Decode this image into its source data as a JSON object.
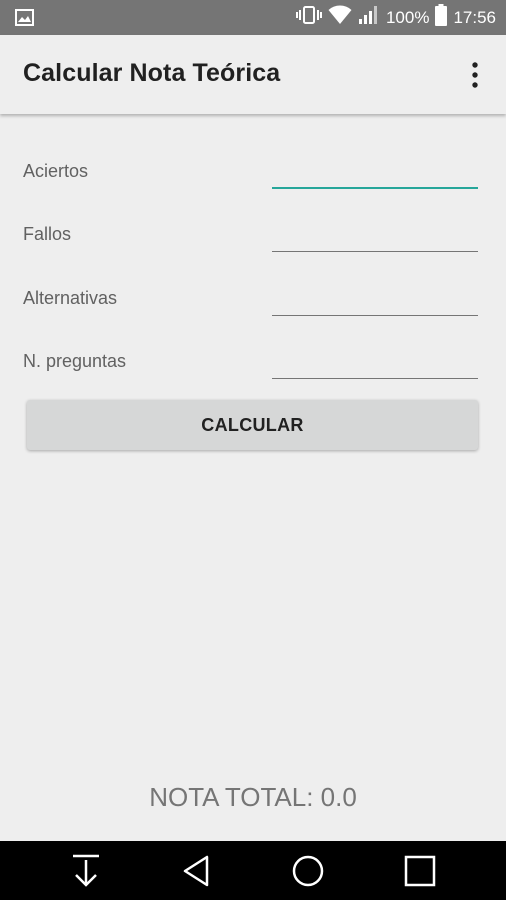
{
  "status_bar": {
    "battery_percent": "100%",
    "time": "17:56",
    "icons": [
      "gallery-icon",
      "vibrate-icon",
      "wifi-icon",
      "signal-icon",
      "battery-icon"
    ]
  },
  "app_bar": {
    "title": "Calcular Nota Teórica",
    "overflow_icon": "more-vert-icon"
  },
  "form": {
    "fields": [
      {
        "label": "Aciertos",
        "value": "",
        "focused": true
      },
      {
        "label": "Fallos",
        "value": ""
      },
      {
        "label": "Alternativas",
        "value": ""
      },
      {
        "label": "N. preguntas",
        "value": ""
      }
    ],
    "button_label": "CALCULAR"
  },
  "result": {
    "total_text": "NOTA TOTAL: 0.0"
  },
  "nav_bar": {
    "icons": [
      "download-icon",
      "back-icon",
      "home-icon",
      "recents-icon"
    ]
  },
  "colors": {
    "accent": "#26a69a",
    "status_bar": "#757575",
    "app_bar": "#eeeeee",
    "button": "#d6d7d7"
  }
}
